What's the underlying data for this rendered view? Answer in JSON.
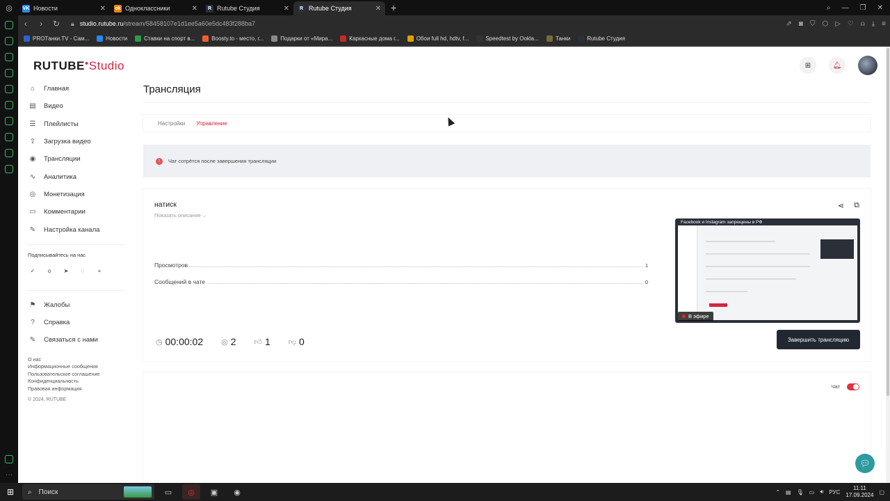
{
  "browser": {
    "tabs": [
      {
        "label": "Новости",
        "color": "#2787f5",
        "glyph": "VK"
      },
      {
        "label": "Одноклассники",
        "color": "#ee8208",
        "glyph": "ok"
      },
      {
        "label": "Rutube Студия",
        "color": "#2a2f38",
        "glyph": "R"
      },
      {
        "label": "Rutube Студия",
        "color": "#2a2f38",
        "glyph": "R"
      }
    ],
    "new_tab": "+",
    "url_host": "studio.rutube.ru",
    "url_path": "/stream/58458107e1d1ee5a60e5dc483f288ba7",
    "bookmarks": [
      {
        "label": "PROTанки.TV - Сам...",
        "color": "#2b63c9"
      },
      {
        "label": "Новости",
        "color": "#2787f5"
      },
      {
        "label": "Ставки на спорт в...",
        "color": "#2a9d48"
      },
      {
        "label": "Boosty.to - место, г...",
        "color": "#f15f2c"
      },
      {
        "label": "Подарки от «Мира...",
        "color": "#8a8a8a"
      },
      {
        "label": "Каркасные дома г...",
        "color": "#c62828"
      },
      {
        "label": "Обои full hd, hdtv, f...",
        "color": "#e0a000"
      },
      {
        "label": "Speedtest by Ookla...",
        "color": "#333333"
      },
      {
        "label": "Танки",
        "color": "#7a6a3a"
      },
      {
        "label": "Rutube Студия",
        "color": "#2a2f38"
      }
    ]
  },
  "app": {
    "logo_main": "RUTUBE",
    "logo_sub": "Studio",
    "nav": [
      {
        "label": "Главная",
        "icon": "home-icon",
        "glyph": "⌂"
      },
      {
        "label": "Видео",
        "icon": "video-icon",
        "glyph": "▤"
      },
      {
        "label": "Плейлисты",
        "icon": "playlist-icon",
        "glyph": "☰"
      },
      {
        "label": "Загрузка видео",
        "icon": "upload-icon",
        "glyph": "⇪"
      },
      {
        "label": "Трансляции",
        "icon": "broadcast-icon",
        "glyph": "◉"
      },
      {
        "label": "Аналитика",
        "icon": "analytics-icon",
        "glyph": "∿"
      },
      {
        "label": "Монетизация",
        "icon": "monetization-icon",
        "glyph": "◎"
      },
      {
        "label": "Комментарии",
        "icon": "comments-icon",
        "glyph": "▭"
      },
      {
        "label": "Настройка канала",
        "icon": "channel-settings-icon",
        "glyph": "✎"
      }
    ],
    "subscribe_label": "Подписывайтесь на нас",
    "socials": [
      {
        "icon": "vk-icon",
        "glyph": "✓"
      },
      {
        "icon": "ok-icon",
        "glyph": "o"
      },
      {
        "icon": "telegram-icon",
        "glyph": "➤"
      },
      {
        "icon": "viber-icon",
        "glyph": "◌"
      },
      {
        "icon": "more-icon",
        "glyph": "+"
      }
    ],
    "nav2": [
      {
        "label": "Жалобы",
        "icon": "flag-icon",
        "glyph": "⚑"
      },
      {
        "label": "Справка",
        "icon": "help-icon",
        "glyph": "?"
      },
      {
        "label": "Связаться с нами",
        "icon": "contact-icon",
        "glyph": "✎"
      }
    ],
    "footer_links": [
      "О нас",
      "Информационные сообщения",
      "Пользовательское соглашение",
      "Конфиденциальность",
      "Правовая информация"
    ],
    "copyright": "© 2024, RUTUBE"
  },
  "main": {
    "title": "Трансляция",
    "tabs": [
      {
        "label": "Настройки",
        "active": false
      },
      {
        "label": "Управление",
        "active": true
      }
    ],
    "notice": "Чат сотрётся после завершения трансляции",
    "stream": {
      "name": "натиск",
      "show_description": "Показать описание ⌵",
      "stats": [
        {
          "label": "Просмотров",
          "value": "1"
        },
        {
          "label": "Сообщений в чате",
          "value": "0"
        }
      ],
      "duration": "00:00:02",
      "viewers": "2",
      "likes": "1",
      "dislikes": "0",
      "preview_title": "Facebook и Instagram запрещены в РФ",
      "live_badge": "В эфире",
      "end_button": "Завершить трансляцию"
    },
    "chat_label": "Чат",
    "chat_enabled": true
  },
  "taskbar": {
    "search_placeholder": "Поиск",
    "lang": "РУС",
    "time": "11:11",
    "date": "17.09.2024"
  }
}
